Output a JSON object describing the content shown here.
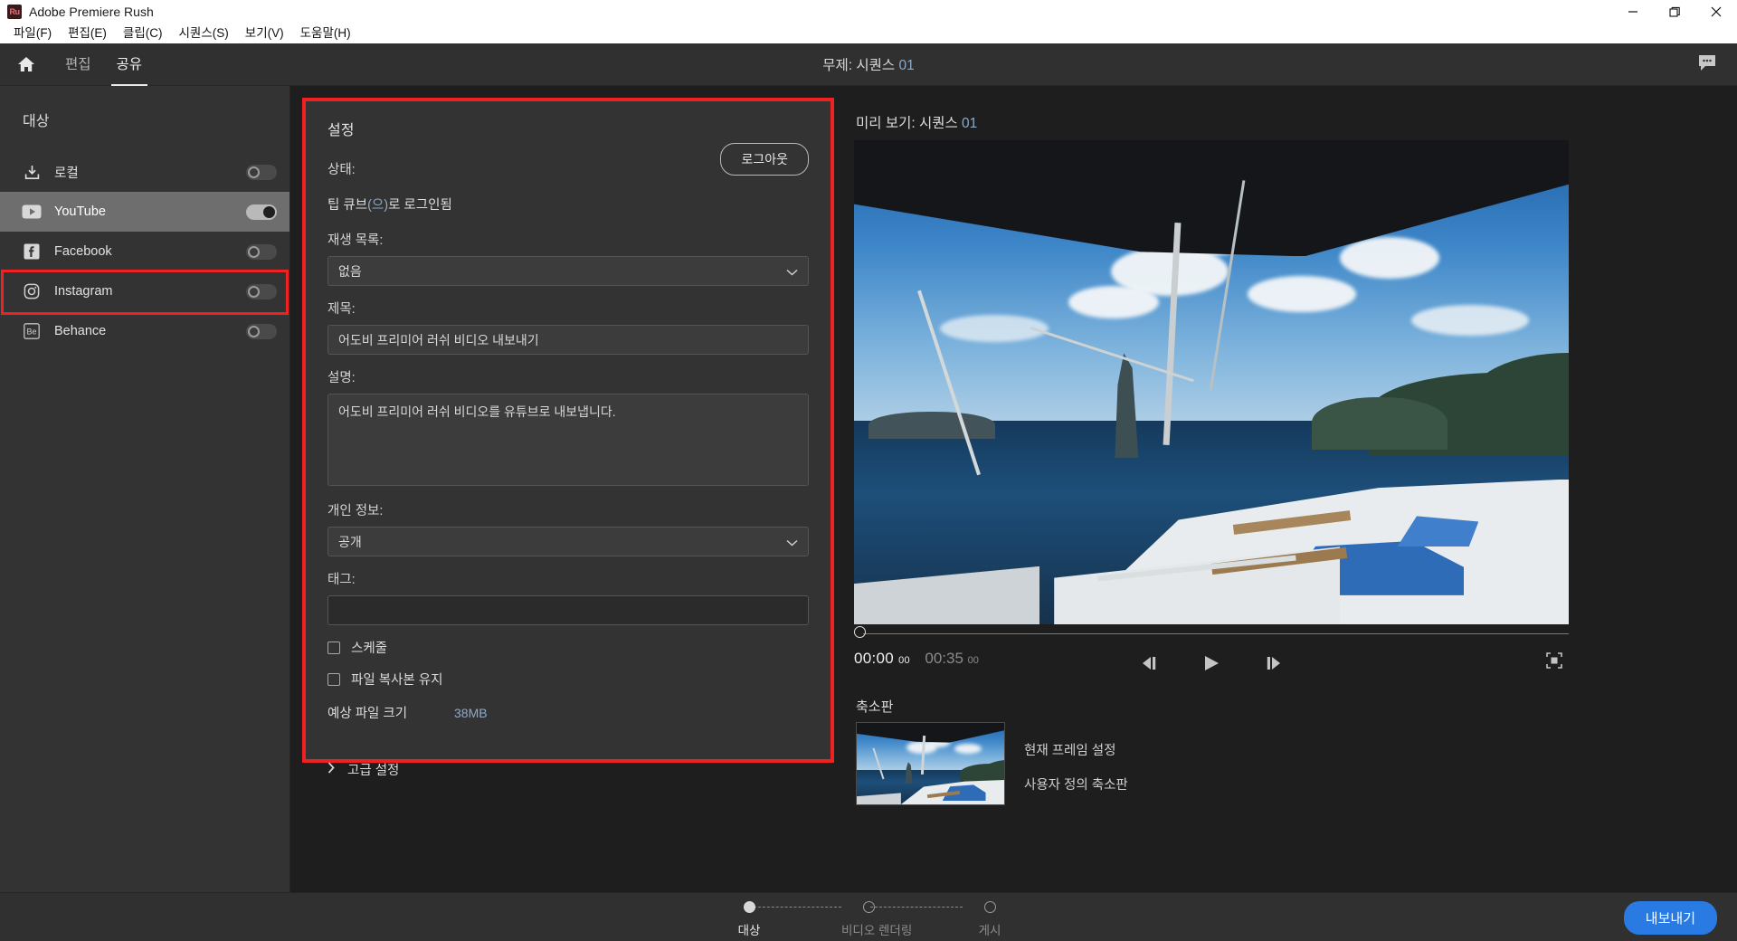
{
  "window": {
    "app_icon": "Ru",
    "title": "Adobe Premiere Rush",
    "minimize": "minimize-icon",
    "maximize": "maximize-icon",
    "close": "close-icon"
  },
  "menubar": {
    "items": [
      {
        "label": "파일(F)"
      },
      {
        "label": "편집(E)"
      },
      {
        "label": "클립(C)"
      },
      {
        "label": "시퀀스(S)"
      },
      {
        "label": "보기(V)"
      },
      {
        "label": "도움말(H)"
      }
    ]
  },
  "appnav": {
    "home_icon": "home-icon",
    "tabs": [
      {
        "label": "편집",
        "active": false
      },
      {
        "label": "공유",
        "active": true
      }
    ],
    "title_prefix": "무제: 시퀀스 ",
    "title_seq": "01",
    "chat_icon": "chat-bubble-icon"
  },
  "sidebar": {
    "title": "대상",
    "items": [
      {
        "label": "로컬",
        "icon": "download-icon",
        "toggle_on": false,
        "selected": false
      },
      {
        "label": "YouTube",
        "icon": "youtube-icon",
        "toggle_on": true,
        "selected": true
      },
      {
        "label": "Facebook",
        "icon": "facebook-icon",
        "toggle_on": false,
        "selected": false
      },
      {
        "label": "Instagram",
        "icon": "instagram-icon",
        "toggle_on": false,
        "selected": false
      },
      {
        "label": "Behance",
        "icon": "behance-icon",
        "toggle_on": false,
        "selected": false
      }
    ]
  },
  "settings": {
    "heading": "설정",
    "status_label": "상태:",
    "logout_label": "로그아웃",
    "status_text_a": "팁 큐브",
    "status_text_paren": "(으)",
    "status_text_b": "로 로그인됨",
    "playlist_label": "재생 목록:",
    "playlist_value": "없음",
    "title_label": "제목:",
    "title_value": "어도비 프리미어 러쉬 비디오 내보내기",
    "description_label": "설명:",
    "description_value": "어도비 프리미어 러쉬 비디오를 유튜브로 내보냅니다.",
    "privacy_label": "개인 정보:",
    "privacy_value": "공개",
    "tags_label": "태그:",
    "tags_value": "",
    "schedule_label": "스케줄",
    "schedule_checked": false,
    "keepcopy_label": "파일 복사본 유지",
    "keepcopy_checked": false,
    "filesize_label": "예상 파일 크기",
    "filesize_value": "38MB",
    "advanced_label": "고급 설정",
    "chevron_right_icon": "chevron-right-icon",
    "chevron_down_icon": "chevron-down-icon"
  },
  "preview": {
    "title_prefix": "미리 보기: 시퀀스 ",
    "title_seq": "01",
    "current_time": "00:00",
    "current_frames": "00",
    "total_time": "00:35",
    "total_frames": "00",
    "step_back_icon": "step-back-icon",
    "play_icon": "play-icon",
    "step_forward_icon": "step-forward-icon",
    "fullscreen_icon": "fullscreen-icon",
    "playhead_icon": "playhead-handle"
  },
  "thumbnail": {
    "heading": "축소판",
    "option_current_frame": "현재 프레임 설정",
    "option_custom": "사용자 정의 축소판"
  },
  "bottom": {
    "steps": [
      {
        "label": "대상",
        "active": true
      },
      {
        "label": "비디오 렌더링",
        "active": false
      },
      {
        "label": "게시",
        "active": false
      }
    ],
    "export_label": "내보내기"
  },
  "colors": {
    "accent_blue": "#2a7ae4",
    "highlight_red": "#ee2222",
    "panel_bg": "#333333",
    "value_blue": "#8ea9c9"
  }
}
